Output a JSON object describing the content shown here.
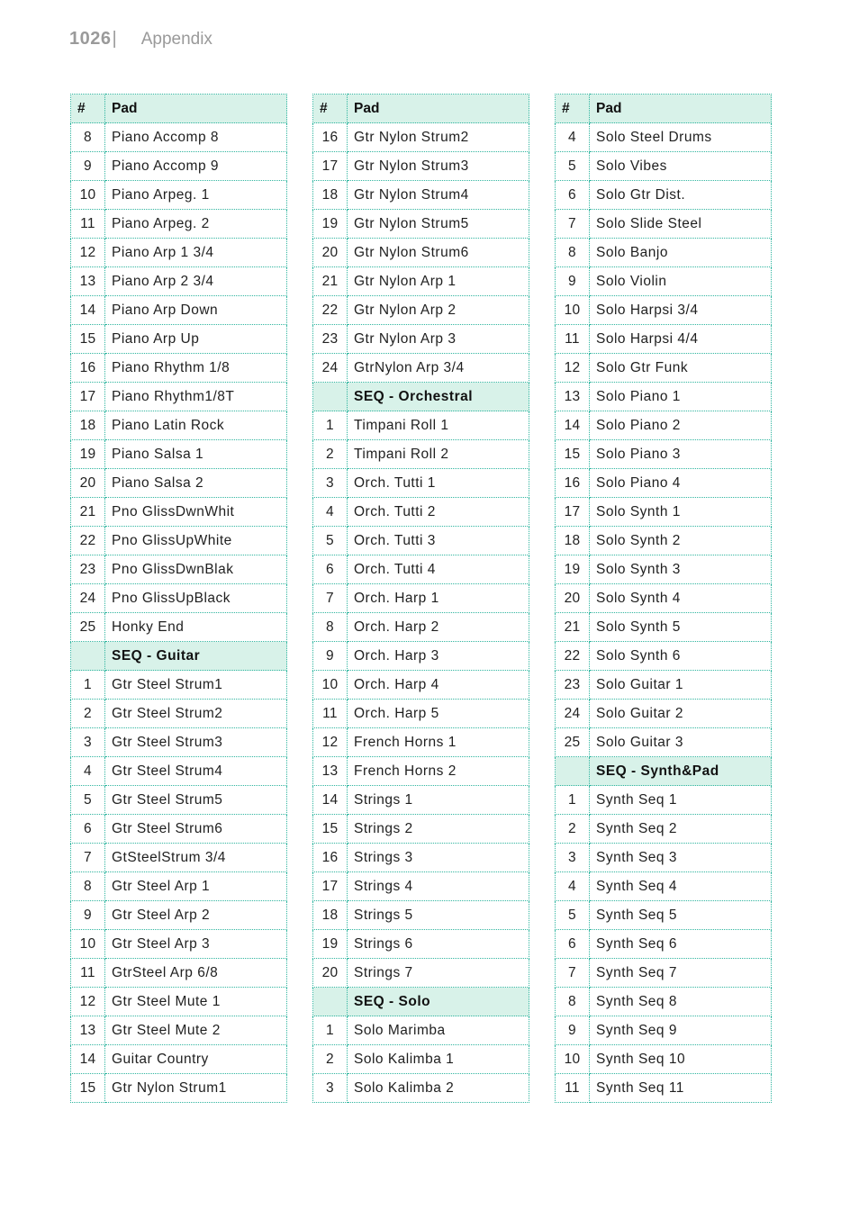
{
  "header": {
    "page_number": "1026",
    "separator": "|",
    "section": "Appendix"
  },
  "colors": {
    "border": "#2fb59f",
    "header_bg": "#d8f2e9"
  },
  "tables": [
    {
      "col_num": "#",
      "col_pad": "Pad",
      "rows": [
        {
          "num": "8",
          "pad": "Piano Accomp 8"
        },
        {
          "num": "9",
          "pad": "Piano Accomp 9"
        },
        {
          "num": "10",
          "pad": "Piano Arpeg. 1"
        },
        {
          "num": "11",
          "pad": "Piano Arpeg. 2"
        },
        {
          "num": "12",
          "pad": "Piano Arp 1 3/4"
        },
        {
          "num": "13",
          "pad": "Piano Arp 2 3/4"
        },
        {
          "num": "14",
          "pad": "Piano Arp Down"
        },
        {
          "num": "15",
          "pad": "Piano Arp Up"
        },
        {
          "num": "16",
          "pad": "Piano Rhythm 1/8"
        },
        {
          "num": "17",
          "pad": "Piano Rhythm1/8T"
        },
        {
          "num": "18",
          "pad": "Piano Latin Rock"
        },
        {
          "num": "19",
          "pad": "Piano Salsa 1"
        },
        {
          "num": "20",
          "pad": "Piano Salsa 2"
        },
        {
          "num": "21",
          "pad": "Pno GlissDwnWhit"
        },
        {
          "num": "22",
          "pad": "Pno GlissUpWhite"
        },
        {
          "num": "23",
          "pad": "Pno GlissDwnBlak"
        },
        {
          "num": "24",
          "pad": "Pno GlissUpBlack"
        },
        {
          "num": "25",
          "pad": "Honky End"
        },
        {
          "section": "SEQ - Guitar"
        },
        {
          "num": "1",
          "pad": "Gtr Steel Strum1"
        },
        {
          "num": "2",
          "pad": "Gtr Steel Strum2"
        },
        {
          "num": "3",
          "pad": "Gtr Steel Strum3"
        },
        {
          "num": "4",
          "pad": "Gtr Steel Strum4"
        },
        {
          "num": "5",
          "pad": "Gtr Steel Strum5"
        },
        {
          "num": "6",
          "pad": "Gtr Steel Strum6"
        },
        {
          "num": "7",
          "pad": "GtSteelStrum 3/4"
        },
        {
          "num": "8",
          "pad": "Gtr Steel Arp 1"
        },
        {
          "num": "9",
          "pad": "Gtr Steel Arp 2"
        },
        {
          "num": "10",
          "pad": "Gtr Steel Arp 3"
        },
        {
          "num": "11",
          "pad": "GtrSteel Arp 6/8"
        },
        {
          "num": "12",
          "pad": "Gtr Steel Mute 1"
        },
        {
          "num": "13",
          "pad": "Gtr Steel Mute 2"
        },
        {
          "num": "14",
          "pad": "Guitar Country"
        },
        {
          "num": "15",
          "pad": "Gtr Nylon Strum1"
        }
      ]
    },
    {
      "col_num": "#",
      "col_pad": "Pad",
      "rows": [
        {
          "num": "16",
          "pad": "Gtr Nylon Strum2"
        },
        {
          "num": "17",
          "pad": "Gtr Nylon Strum3"
        },
        {
          "num": "18",
          "pad": "Gtr Nylon Strum4"
        },
        {
          "num": "19",
          "pad": "Gtr Nylon Strum5"
        },
        {
          "num": "20",
          "pad": "Gtr Nylon Strum6"
        },
        {
          "num": "21",
          "pad": "Gtr Nylon Arp 1"
        },
        {
          "num": "22",
          "pad": "Gtr Nylon Arp 2"
        },
        {
          "num": "23",
          "pad": "Gtr Nylon Arp 3"
        },
        {
          "num": "24",
          "pad": "GtrNylon Arp 3/4"
        },
        {
          "section": "SEQ - Orchestral"
        },
        {
          "num": "1",
          "pad": "Timpani Roll 1"
        },
        {
          "num": "2",
          "pad": "Timpani Roll 2"
        },
        {
          "num": "3",
          "pad": "Orch. Tutti 1"
        },
        {
          "num": "4",
          "pad": "Orch. Tutti 2"
        },
        {
          "num": "5",
          "pad": "Orch. Tutti 3"
        },
        {
          "num": "6",
          "pad": "Orch. Tutti 4"
        },
        {
          "num": "7",
          "pad": "Orch. Harp 1"
        },
        {
          "num": "8",
          "pad": "Orch. Harp 2"
        },
        {
          "num": "9",
          "pad": "Orch. Harp 3"
        },
        {
          "num": "10",
          "pad": "Orch. Harp 4"
        },
        {
          "num": "11",
          "pad": "Orch. Harp 5"
        },
        {
          "num": "12",
          "pad": "French Horns 1"
        },
        {
          "num": "13",
          "pad": "French Horns 2"
        },
        {
          "num": "14",
          "pad": "Strings 1"
        },
        {
          "num": "15",
          "pad": "Strings 2"
        },
        {
          "num": "16",
          "pad": "Strings 3"
        },
        {
          "num": "17",
          "pad": "Strings 4"
        },
        {
          "num": "18",
          "pad": "Strings 5"
        },
        {
          "num": "19",
          "pad": "Strings 6"
        },
        {
          "num": "20",
          "pad": "Strings 7"
        },
        {
          "section": "SEQ - Solo"
        },
        {
          "num": "1",
          "pad": "Solo Marimba"
        },
        {
          "num": "2",
          "pad": "Solo Kalimba 1"
        },
        {
          "num": "3",
          "pad": "Solo Kalimba 2"
        }
      ]
    },
    {
      "col_num": "#",
      "col_pad": "Pad",
      "rows": [
        {
          "num": "4",
          "pad": "Solo Steel Drums"
        },
        {
          "num": "5",
          "pad": "Solo Vibes"
        },
        {
          "num": "6",
          "pad": "Solo Gtr Dist."
        },
        {
          "num": "7",
          "pad": "Solo Slide Steel"
        },
        {
          "num": "8",
          "pad": "Solo Banjo"
        },
        {
          "num": "9",
          "pad": "Solo Violin"
        },
        {
          "num": "10",
          "pad": "Solo Harpsi 3/4"
        },
        {
          "num": "11",
          "pad": "Solo Harpsi 4/4"
        },
        {
          "num": "12",
          "pad": "Solo Gtr Funk"
        },
        {
          "num": "13",
          "pad": "Solo Piano 1"
        },
        {
          "num": "14",
          "pad": "Solo Piano 2"
        },
        {
          "num": "15",
          "pad": "Solo Piano 3"
        },
        {
          "num": "16",
          "pad": "Solo Piano 4"
        },
        {
          "num": "17",
          "pad": "Solo Synth 1"
        },
        {
          "num": "18",
          "pad": "Solo Synth 2"
        },
        {
          "num": "19",
          "pad": "Solo Synth 3"
        },
        {
          "num": "20",
          "pad": "Solo Synth 4"
        },
        {
          "num": "21",
          "pad": "Solo Synth 5"
        },
        {
          "num": "22",
          "pad": "Solo Synth 6"
        },
        {
          "num": "23",
          "pad": "Solo Guitar 1"
        },
        {
          "num": "24",
          "pad": "Solo Guitar 2"
        },
        {
          "num": "25",
          "pad": "Solo Guitar 3"
        },
        {
          "section": "SEQ - Synth&Pad"
        },
        {
          "num": "1",
          "pad": "Synth Seq 1"
        },
        {
          "num": "2",
          "pad": "Synth Seq 2"
        },
        {
          "num": "3",
          "pad": "Synth Seq 3"
        },
        {
          "num": "4",
          "pad": "Synth Seq 4"
        },
        {
          "num": "5",
          "pad": "Synth Seq 5"
        },
        {
          "num": "6",
          "pad": "Synth Seq 6"
        },
        {
          "num": "7",
          "pad": "Synth Seq 7"
        },
        {
          "num": "8",
          "pad": "Synth Seq 8"
        },
        {
          "num": "9",
          "pad": "Synth Seq 9"
        },
        {
          "num": "10",
          "pad": "Synth Seq 10"
        },
        {
          "num": "11",
          "pad": "Synth Seq 11"
        }
      ]
    }
  ]
}
